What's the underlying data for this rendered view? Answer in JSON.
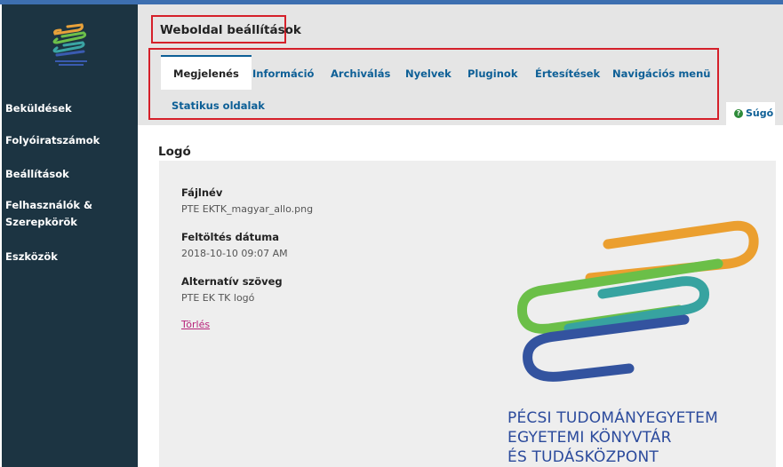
{
  "app": {
    "brand_colors": {
      "sidebar": "#1c3442",
      "accent": "#0d5f96",
      "highlight": "#d5202a",
      "link": "#b8237a"
    }
  },
  "sidebar": {
    "items": [
      {
        "label": "Beküldések"
      },
      {
        "label": "Folyóiratszámok"
      },
      {
        "label": "Beállítások"
      },
      {
        "label": "Felhasználók &"
      },
      {
        "label": "Szerepkörök"
      },
      {
        "label": "Eszközök"
      }
    ]
  },
  "header": {
    "title": "Weboldal beállítások"
  },
  "tabs": [
    {
      "label": "Megjelenés",
      "active": true
    },
    {
      "label": "Információ"
    },
    {
      "label": "Archiválás"
    },
    {
      "label": "Nyelvek"
    },
    {
      "label": "Pluginok"
    },
    {
      "label": "Értesítések"
    },
    {
      "label": "Navigációs menü"
    },
    {
      "label": "Statikus oldalak"
    }
  ],
  "help": {
    "icon": "help-icon",
    "glyph": "?",
    "label": "Súgó"
  },
  "logo_section": {
    "title": "Logó",
    "filename_label": "Fájlnév",
    "filename_value": "PTE EKTK_magyar_allo.png",
    "upload_label": "Feltöltés dátuma",
    "upload_value": "2018-10-10 09:07 AM",
    "alt_label": "Alternatív szöveg",
    "alt_value": "PTE EK TK logó",
    "delete_label": "Törlés",
    "logo_lines": [
      "PÉCSI TUDOMÁNYEGYETEM",
      "EGYETEMI KÖNYVTÁR",
      "ÉS TUDÁSKÖZPONT"
    ]
  }
}
